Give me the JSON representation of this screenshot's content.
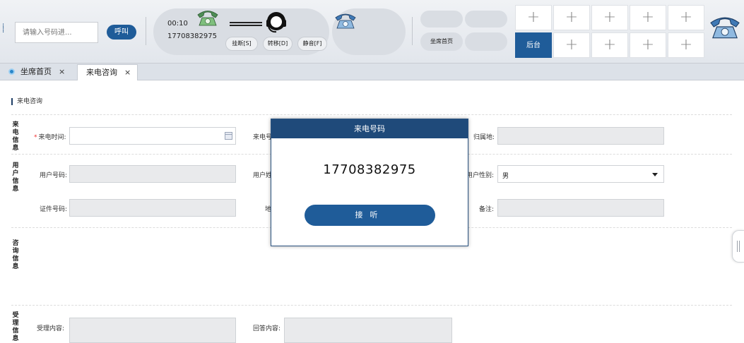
{
  "toolbar": {
    "dial_placeholder": "请输入号码进...",
    "call_label": "呼叫",
    "call_time": "00:10",
    "call_number": "17708382975",
    "hangup_label": "挂断[S]",
    "transfer_label": "转移[D]",
    "mute_label": "静音[F]",
    "home_label": "坐席首页",
    "backstage_label": "后台",
    "grid_plus": "+"
  },
  "tabs": [
    {
      "label": "坐席首页",
      "close": "×"
    },
    {
      "label": "来电咨询",
      "close": "×"
    }
  ],
  "form": {
    "section_title": "来电咨询",
    "group_caller": "来电信息",
    "group_user": "用户信息",
    "group_consult": "咨询信息",
    "group_accept": "受理信息",
    "required_mark": "*",
    "call_time_label": "来电时间:",
    "caller_number_label": "来电号",
    "location_label": "归属地:",
    "user_number_label": "用户号码:",
    "user_name_label": "用户姓",
    "user_gender_label": "用户性别:",
    "user_gender_value": "男",
    "id_number_label": "证件号码:",
    "address_label": "地",
    "remark_label": "备注:",
    "accept_content_label": "受理内容:",
    "answer_content_label": "回答内容:"
  },
  "modal": {
    "title": "来电号码",
    "number": "17708382975",
    "answer_label": "接听"
  },
  "colors": {
    "primary": "#1f5c99",
    "modal_header": "#1f4a7a",
    "required": "#ee3333"
  },
  "icons": [
    "grip-icon",
    "green-phone-icon",
    "headset-icon",
    "blue-phone-icon",
    "calendar-icon",
    "close-icon",
    "caret-down-icon"
  ]
}
